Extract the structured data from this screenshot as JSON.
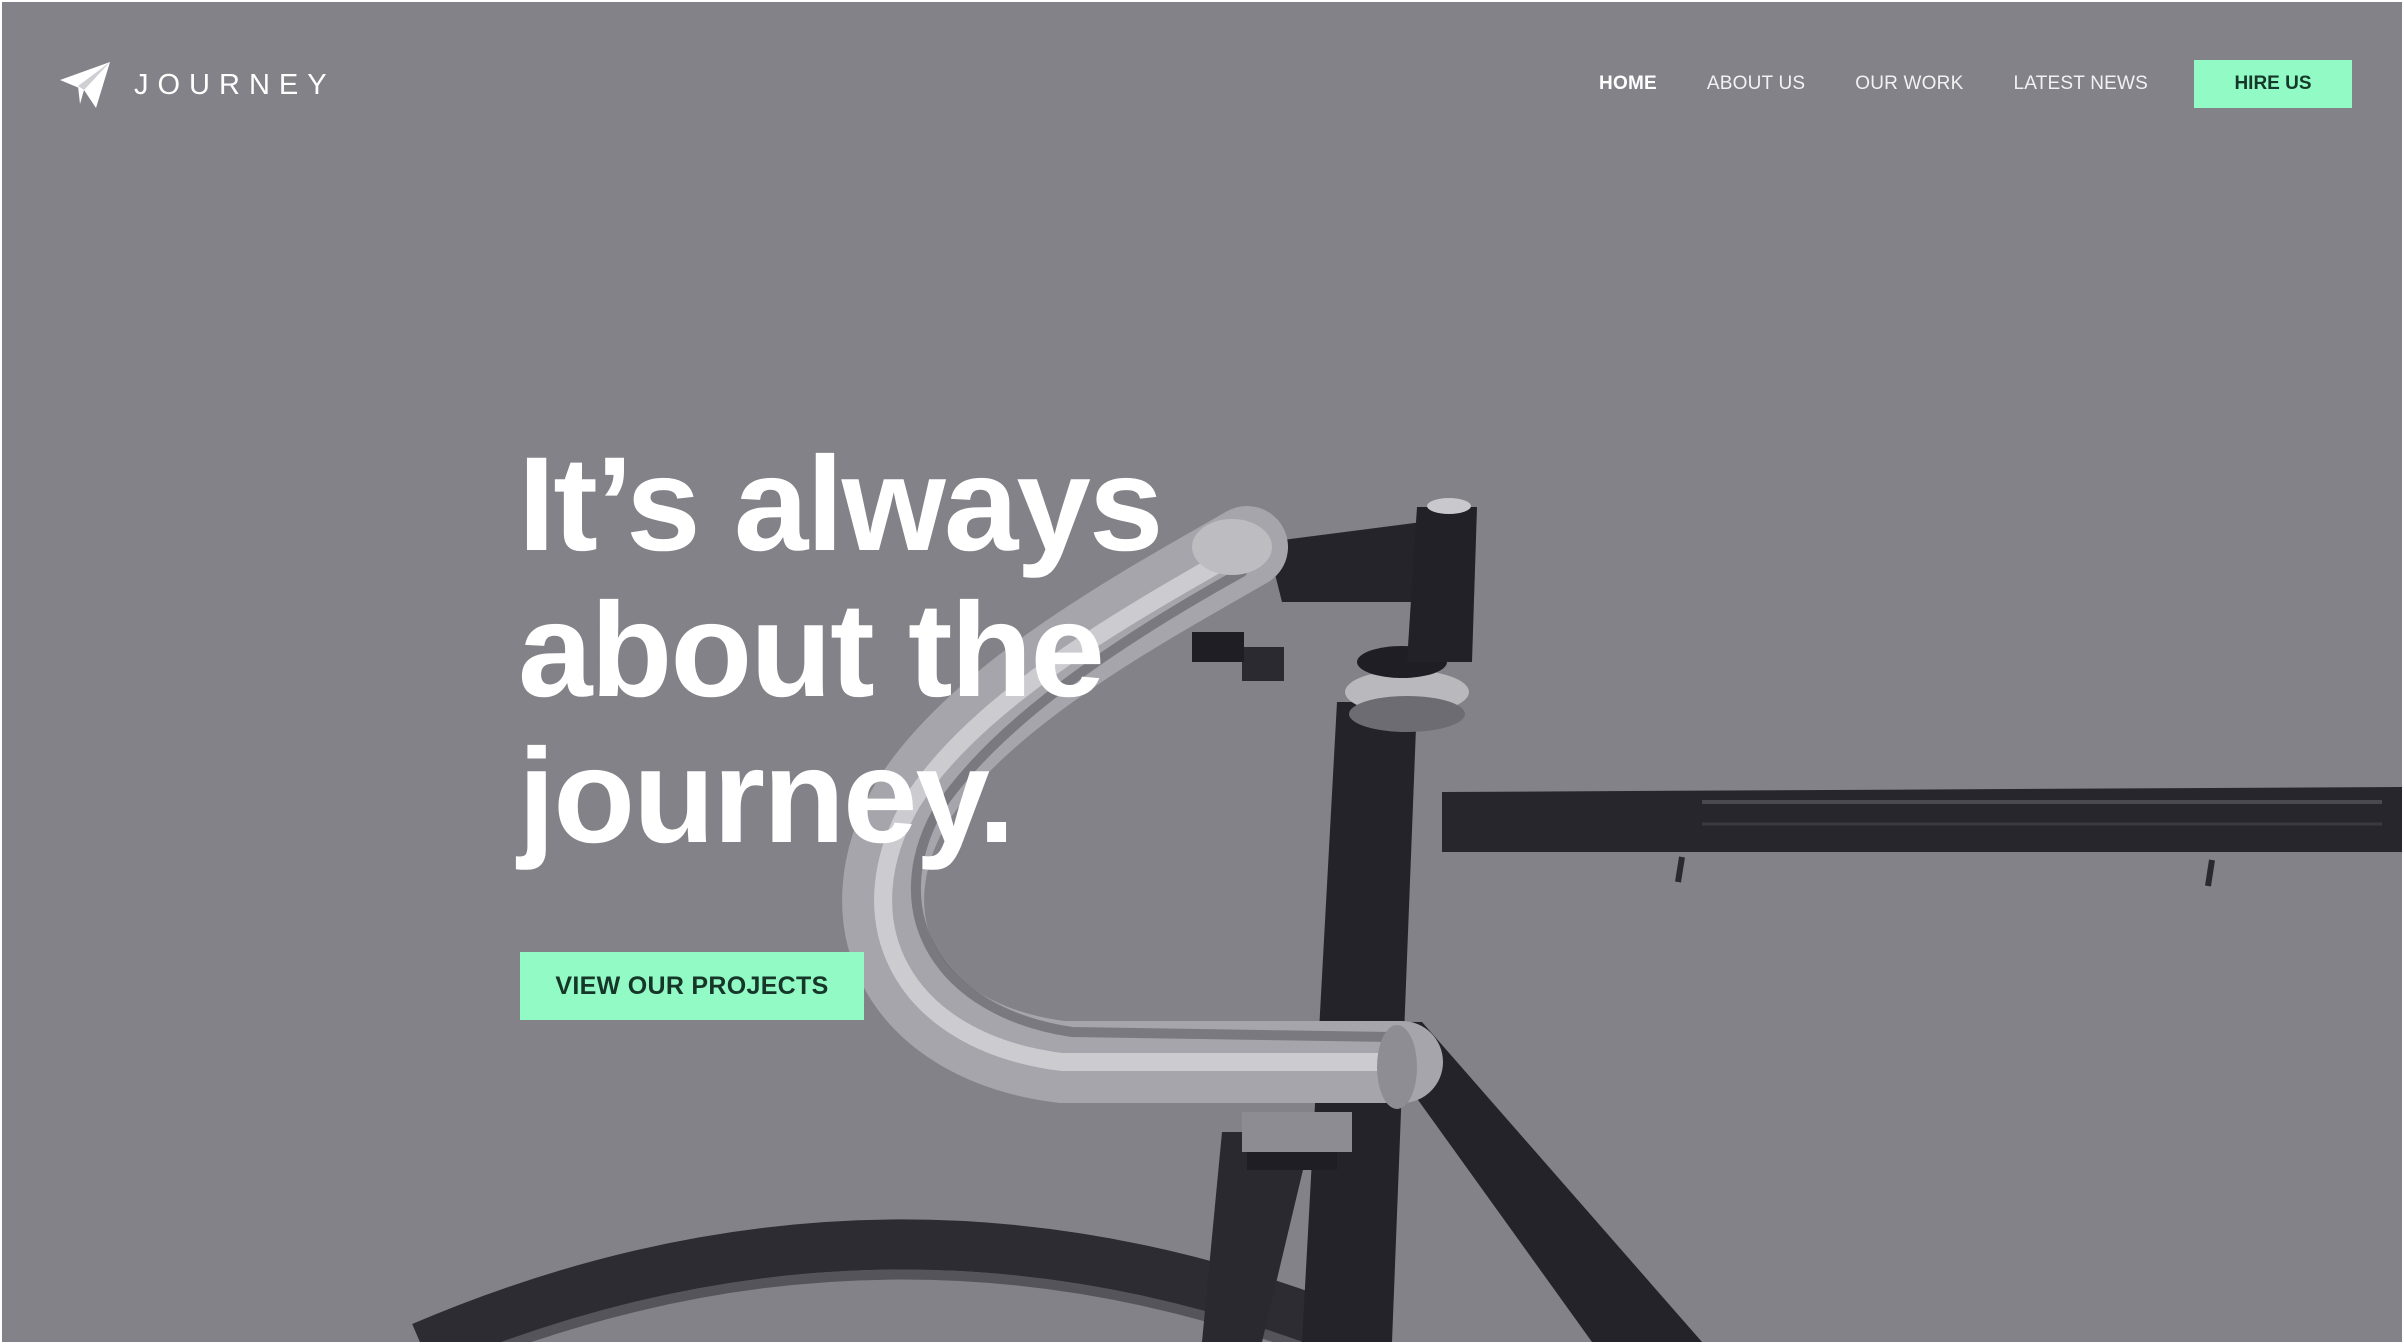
{
  "brand": {
    "name": "JOURNEY",
    "icon": "paper-plane-icon"
  },
  "nav": {
    "items": [
      {
        "label": "HOME",
        "active": true
      },
      {
        "label": "ABOUT US"
      },
      {
        "label": "OUR WORK"
      },
      {
        "label": "LATEST NEWS"
      }
    ],
    "cta_label": "HIRE US"
  },
  "hero": {
    "title_lines": [
      "It’s always",
      "about the",
      "journey."
    ],
    "button_label": "VIEW OUR PROJECTS"
  },
  "colors": {
    "background": "#838288",
    "accent": "#92fac4",
    "text": "#ffffff"
  }
}
